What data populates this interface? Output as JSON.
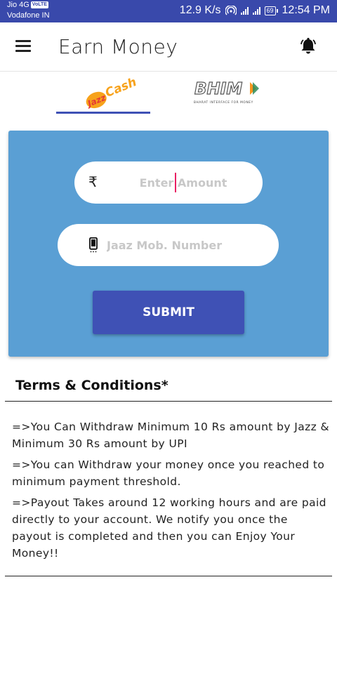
{
  "status_bar": {
    "carrier_1": "Jio 4G",
    "volte_badge": "VoLTE",
    "carrier_2": "Vodafone IN",
    "net_speed": "12.9 K/s",
    "battery": "69",
    "time": "12:54 PM"
  },
  "app_bar": {
    "title": "Earn Money",
    "menu_icon": "menu-icon",
    "bell_icon": "bell-icon"
  },
  "payment_tabs": {
    "selected": "jazzcash",
    "tabs": [
      {
        "id": "jazzcash",
        "label": "JazzCash"
      },
      {
        "id": "bhim",
        "label": "BHIM",
        "tagline": "BHARAT INTERFACE FOR MONEY"
      }
    ]
  },
  "form": {
    "amount_placeholder": "Enter Amount",
    "amount_value": "",
    "mobile_placeholder": "Jaaz Mob. Number",
    "mobile_value": "",
    "currency_symbol": "₹",
    "submit_label": "SUBMIT"
  },
  "terms": {
    "title": "Terms & Conditions*",
    "items": [
      "=>You Can Withdraw Minimum 10 Rs amount by Jazz & Minimum 30 Rs amount by UPI",
      "=>You can Withdraw your money once you reached to minimum payment threshold.",
      "=>Payout Takes around 12 working hours and are paid directly to your account. We notify you once the payout is completed and then you can Enjoy Your Money!!"
    ]
  },
  "colors": {
    "status_bar": "#3949ab",
    "card_bg": "#5a9fd4",
    "accent": "#3f51b5",
    "caret": "#e91e63",
    "jazz_red": "#e53935",
    "jazz_orange": "#f7a21b",
    "bhim_orange": "#f7941d",
    "bhim_green": "#2e8b57"
  }
}
